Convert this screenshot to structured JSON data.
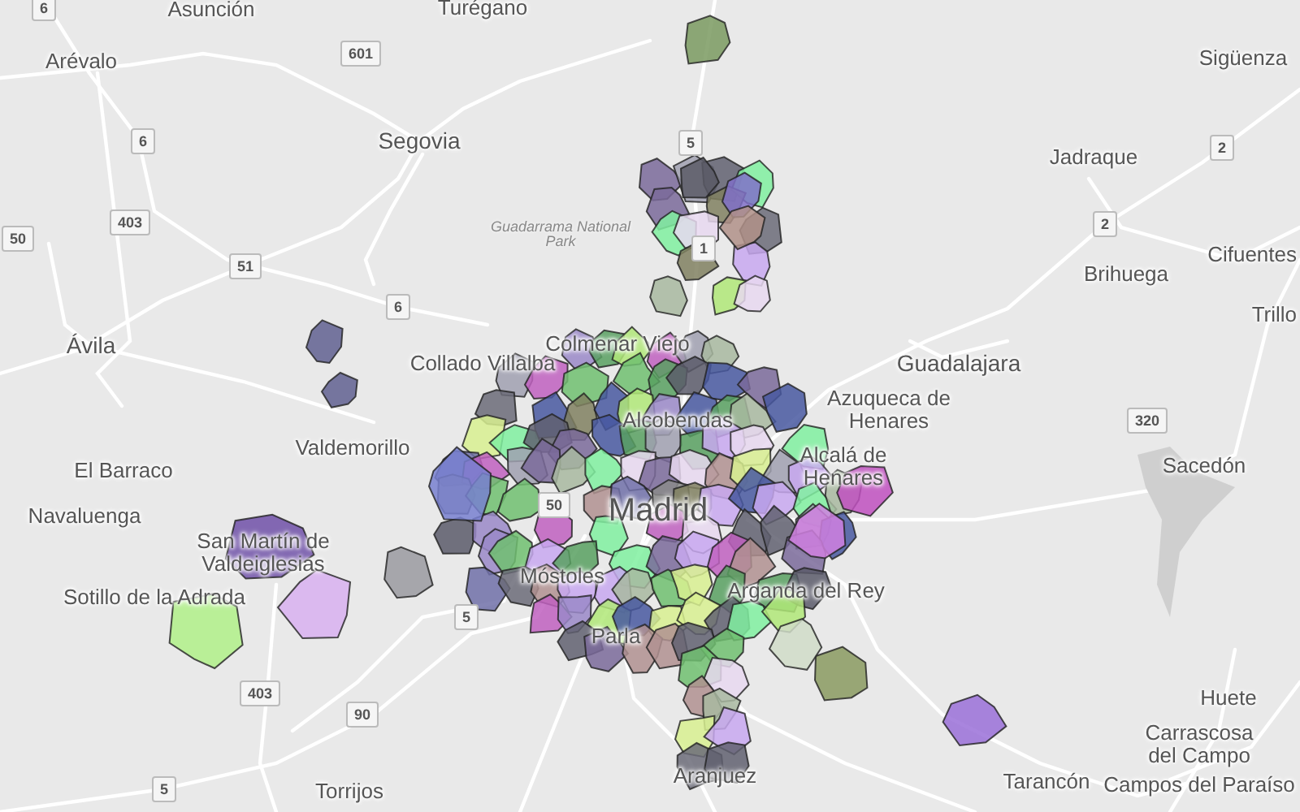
{
  "map": {
    "places": [
      {
        "name": "Asunción",
        "kind": "town"
      },
      {
        "name": "Turégano",
        "kind": "town"
      },
      {
        "name": "Arévalo",
        "kind": "town"
      },
      {
        "name": "Sigüenza",
        "kind": "town"
      },
      {
        "name": "Segovia",
        "kind": "city"
      },
      {
        "name": "Jadraque",
        "kind": "town"
      },
      {
        "name": "Guadarrama National Park",
        "kind": "park"
      },
      {
        "name": "Brihuega",
        "kind": "town"
      },
      {
        "name": "Cifuentes",
        "kind": "town"
      },
      {
        "name": "Trillo",
        "kind": "town"
      },
      {
        "name": "Ávila",
        "kind": "city"
      },
      {
        "name": "Collado Villalba",
        "kind": "town"
      },
      {
        "name": "Colmenar Viejo",
        "kind": "town"
      },
      {
        "name": "Guadalajara",
        "kind": "city"
      },
      {
        "name": "Alcobendas",
        "kind": "town"
      },
      {
        "name": "Azuqueca de Henares",
        "kind": "town"
      },
      {
        "name": "El Barraco",
        "kind": "town"
      },
      {
        "name": "Valdemorillo",
        "kind": "town"
      },
      {
        "name": "Alcalá de Henares",
        "kind": "town"
      },
      {
        "name": "Sacedón",
        "kind": "town"
      },
      {
        "name": "Navaluenga",
        "kind": "town"
      },
      {
        "name": "Madrid",
        "kind": "capital"
      },
      {
        "name": "San Martín de Valdeiglesias",
        "kind": "town"
      },
      {
        "name": "Sotillo de la Adrada",
        "kind": "town"
      },
      {
        "name": "Móstoles",
        "kind": "town"
      },
      {
        "name": "Arganda del Rey",
        "kind": "town"
      },
      {
        "name": "Parla",
        "kind": "town"
      },
      {
        "name": "Huete",
        "kind": "town"
      },
      {
        "name": "Carrascosa del Campo",
        "kind": "town"
      },
      {
        "name": "Torrijos",
        "kind": "town"
      },
      {
        "name": "Aranjuez",
        "kind": "town"
      },
      {
        "name": "Tarancón",
        "kind": "town"
      },
      {
        "name": "Campos del Paraíso",
        "kind": "town"
      }
    ],
    "road_shields": [
      "6",
      "601",
      "5",
      "2",
      "6",
      "403",
      "50",
      "51",
      "1",
      "2",
      "6",
      "320",
      "50",
      "5",
      "403",
      "90",
      "5"
    ]
  }
}
